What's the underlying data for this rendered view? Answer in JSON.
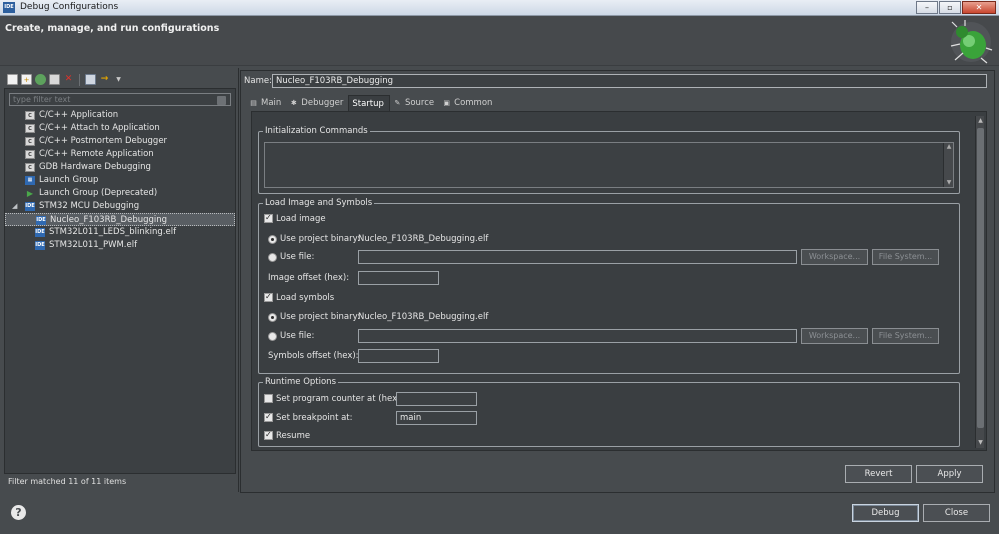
{
  "window": {
    "title": "Debug Configurations",
    "app_icon_text": "IDE",
    "minimize": "–",
    "maximize": "▫",
    "close": "✕"
  },
  "banner": {
    "heading": "Create, manage, and run configurations"
  },
  "left": {
    "toolbar_icons": [
      "new-config-icon",
      "new-prototype-icon",
      "export-icon",
      "duplicate-icon",
      "delete-icon",
      "collapse-all-icon",
      "filter-icon"
    ],
    "filter_placeholder": "type filter text",
    "tree": [
      {
        "label": "C/C++ Application",
        "icon": "c-config-icon",
        "icon_text": "C",
        "level": 1
      },
      {
        "label": "C/C++ Attach to Application",
        "icon": "c-config-icon",
        "icon_text": "C",
        "level": 1
      },
      {
        "label": "C/C++ Postmortem Debugger",
        "icon": "c-config-icon",
        "icon_text": "C",
        "level": 1
      },
      {
        "label": "C/C++ Remote Application",
        "icon": "c-config-icon",
        "icon_text": "C",
        "level": 1
      },
      {
        "label": "GDB Hardware Debugging",
        "icon": "c-config-icon",
        "icon_text": "C",
        "level": 1
      },
      {
        "label": "Launch Group",
        "icon": "launch-group-icon",
        "icon_text": "▦",
        "level": 1
      },
      {
        "label": "Launch Group (Deprecated)",
        "icon": "launch-arrow-icon",
        "icon_text": "▶",
        "level": 1
      },
      {
        "label": "STM32 MCU Debugging",
        "icon": "ide-icon",
        "icon_text": "IDE",
        "level": 1,
        "expanded": true
      },
      {
        "label": "Nucleo_F103RB_Debugging",
        "icon": "ide-icon",
        "icon_text": "IDE",
        "level": 2,
        "selected": true
      },
      {
        "label": "STM32L011_LEDS_blinking.elf",
        "icon": "ide-icon",
        "icon_text": "IDE",
        "level": 2
      },
      {
        "label": "STM32L011_PWM.elf",
        "icon": "ide-icon",
        "icon_text": "IDE",
        "level": 2
      }
    ],
    "status": "Filter matched 11 of 11 items"
  },
  "config": {
    "name_label": "Name:",
    "name_value": "Nucleo_F103RB_Debugging",
    "tabs": [
      {
        "label": "Main",
        "icon": "main-tab-icon",
        "glyph": "▤"
      },
      {
        "label": "Debugger",
        "icon": "debugger-tab-icon",
        "glyph": "✱"
      },
      {
        "label": "Startup",
        "icon": "",
        "glyph": "",
        "active": true
      },
      {
        "label": "Source",
        "icon": "source-tab-icon",
        "glyph": "✎"
      },
      {
        "label": "Common",
        "icon": "common-tab-icon",
        "glyph": "▣"
      }
    ]
  },
  "startup": {
    "init_legend": "Initialization Commands",
    "init_commands": "",
    "load_legend": "Load Image and Symbols",
    "load_image_label": "Load image",
    "load_image_checked": true,
    "img_use_project_label": "Use project binary:",
    "img_project_binary": "Nucleo_F103RB_Debugging.elf",
    "img_use_file_label": "Use file:",
    "img_file_value": "",
    "workspace_label": "Workspace...",
    "filesystem_label": "File System...",
    "image_offset_label": "Image offset (hex):",
    "image_offset_value": "",
    "load_symbols_label": "Load symbols",
    "load_symbols_checked": true,
    "sym_use_project_label": "Use project binary:",
    "sym_project_binary": "Nucleo_F103RB_Debugging.elf",
    "sym_use_file_label": "Use file:",
    "sym_file_value": "",
    "symbols_offset_label": "Symbols offset (hex):",
    "symbols_offset_value": "",
    "runtime_legend": "Runtime Options",
    "set_pc_label": "Set program counter at (hex):",
    "set_pc_value": "",
    "set_bp_label": "Set breakpoint at:",
    "set_bp_value": "main",
    "resume_label": "Resume"
  },
  "buttons": {
    "revert": "Revert",
    "apply": "Apply",
    "debug": "Debug",
    "close": "Close",
    "help": "?"
  }
}
